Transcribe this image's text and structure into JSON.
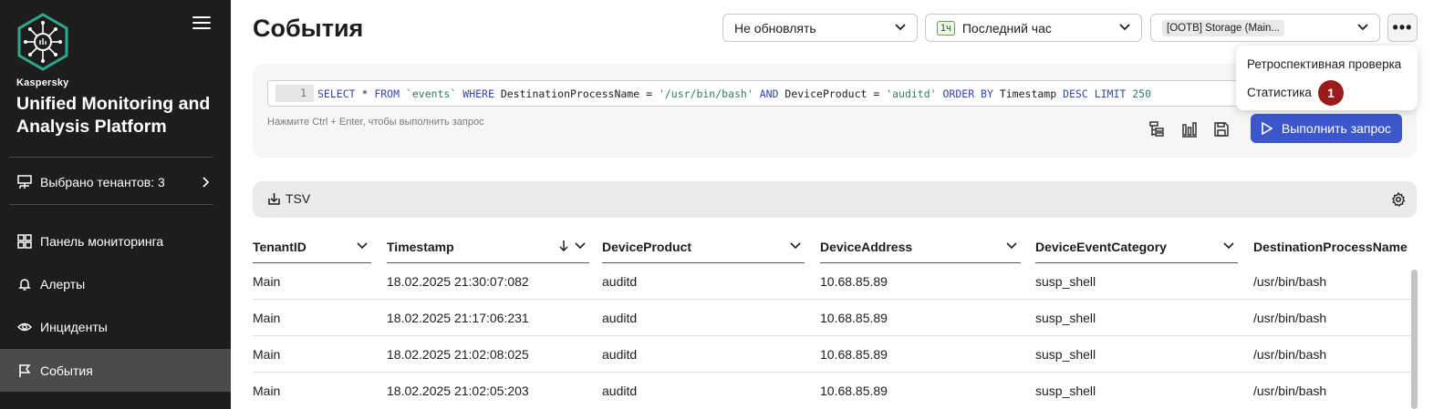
{
  "sidebar": {
    "brand_small": "Kaspersky",
    "brand_title": "Unified Monitoring and Analysis Platform",
    "tenants_label": "Выбрано тенантов: 3",
    "nav": [
      {
        "label": "Панель мониторинга",
        "icon": "dashboard-icon"
      },
      {
        "label": "Алерты",
        "icon": "bell-icon"
      },
      {
        "label": "Инциденты",
        "icon": "eye-icon"
      },
      {
        "label": "События",
        "icon": "flag-icon",
        "active": true
      }
    ]
  },
  "header": {
    "title": "События",
    "refresh_select": "Не обновлять",
    "period_badge": "1ч",
    "period_select": "Последний час",
    "storage_select": "[OOTB] Storage (Main..."
  },
  "query": {
    "line_number": "1",
    "sql": {
      "k_select": "SELECT",
      "star": " * ",
      "k_from": "FROM",
      "table": " `events` ",
      "k_where": "WHERE",
      "field1": " DestinationProcessName = ",
      "val1": "'/usr/bin/bash'",
      "k_and": " AND ",
      "field2": "DeviceProduct = ",
      "val2": "'auditd'",
      "k_order": " ORDER BY ",
      "field3": "Timestamp ",
      "k_desc": "DESC",
      "k_limit": " LIMIT ",
      "limit": "250"
    },
    "hint": "Нажмите Ctrl + Enter, чтобы выполнить запрос",
    "run_label": "Выполнить запрос"
  },
  "menu": {
    "items": [
      "Ретроспективная проверка",
      "Статистика"
    ],
    "step_badge": "1"
  },
  "export": {
    "tsv_label": "TSV"
  },
  "table": {
    "columns": [
      "TenantID",
      "Timestamp",
      "DeviceProduct",
      "DeviceAddress",
      "DeviceEventCategory",
      "DestinationProcessName"
    ],
    "rows": [
      [
        "Main",
        "18.02.2025 21:30:07:082",
        "auditd",
        "10.68.85.89",
        "susp_shell",
        "/usr/bin/bash"
      ],
      [
        "Main",
        "18.02.2025 21:17:06:231",
        "auditd",
        "10.68.85.89",
        "susp_shell",
        "/usr/bin/bash"
      ],
      [
        "Main",
        "18.02.2025 21:02:08:025",
        "auditd",
        "10.68.85.89",
        "susp_shell",
        "/usr/bin/bash"
      ],
      [
        "Main",
        "18.02.2025 21:02:05:203",
        "auditd",
        "10.68.85.89",
        "susp_shell",
        "/usr/bin/bash"
      ]
    ]
  },
  "colors": {
    "sidebar_bg": "#1d1d1b",
    "active_nav": "#4b4b49",
    "accent_blue": "#3c57c9",
    "step_badge": "#9b1a1a",
    "logo_teal": "#2fa68f"
  }
}
